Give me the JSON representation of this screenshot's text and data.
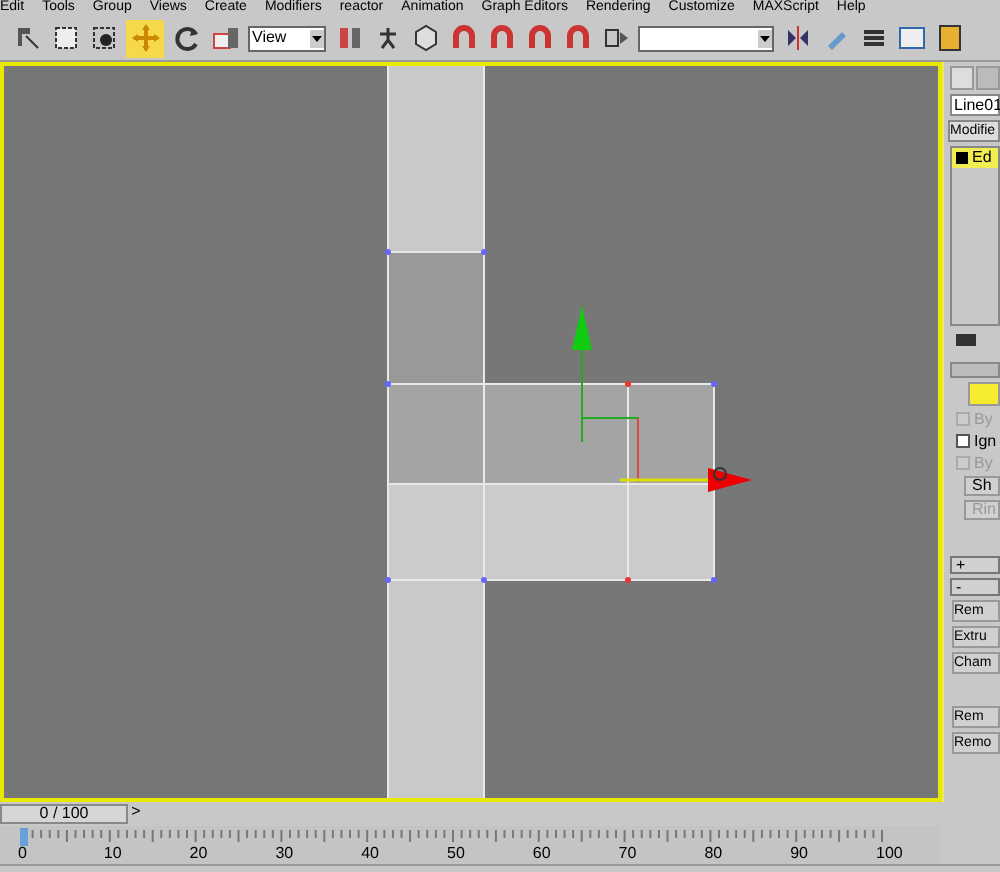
{
  "menu": [
    "Edit",
    "Tools",
    "Group",
    "Views",
    "Create",
    "Modifiers",
    "reactor",
    "Animation",
    "Graph Editors",
    "Rendering",
    "Customize",
    "MAXScript",
    "Help"
  ],
  "toolbar": {
    "view_dropdown": "View",
    "move_selected": true
  },
  "panel": {
    "object_name": "Line01",
    "modifier_list": "Modifie",
    "stack_item": "Ed",
    "checkboxes": [
      {
        "label": "By",
        "checked": false,
        "disabled": true
      },
      {
        "label": "Ign",
        "checked": false,
        "disabled": false
      },
      {
        "label": "By",
        "checked": false,
        "disabled": true
      }
    ],
    "buttons_top": [
      {
        "label": "Sh",
        "disabled": false
      },
      {
        "label": "Rin",
        "disabled": true
      }
    ],
    "rollouts": [
      "+",
      "-"
    ],
    "buttons_bottom": [
      "Rem",
      "Extru",
      "Cham",
      "Rem",
      "Remo"
    ]
  },
  "timeline": {
    "frame": "0 / 100",
    "level": 0,
    "next": ">",
    "ticks": [
      "0",
      "10",
      "20",
      "30",
      "40",
      "50",
      "60",
      "70",
      "80",
      "90",
      "100"
    ]
  }
}
